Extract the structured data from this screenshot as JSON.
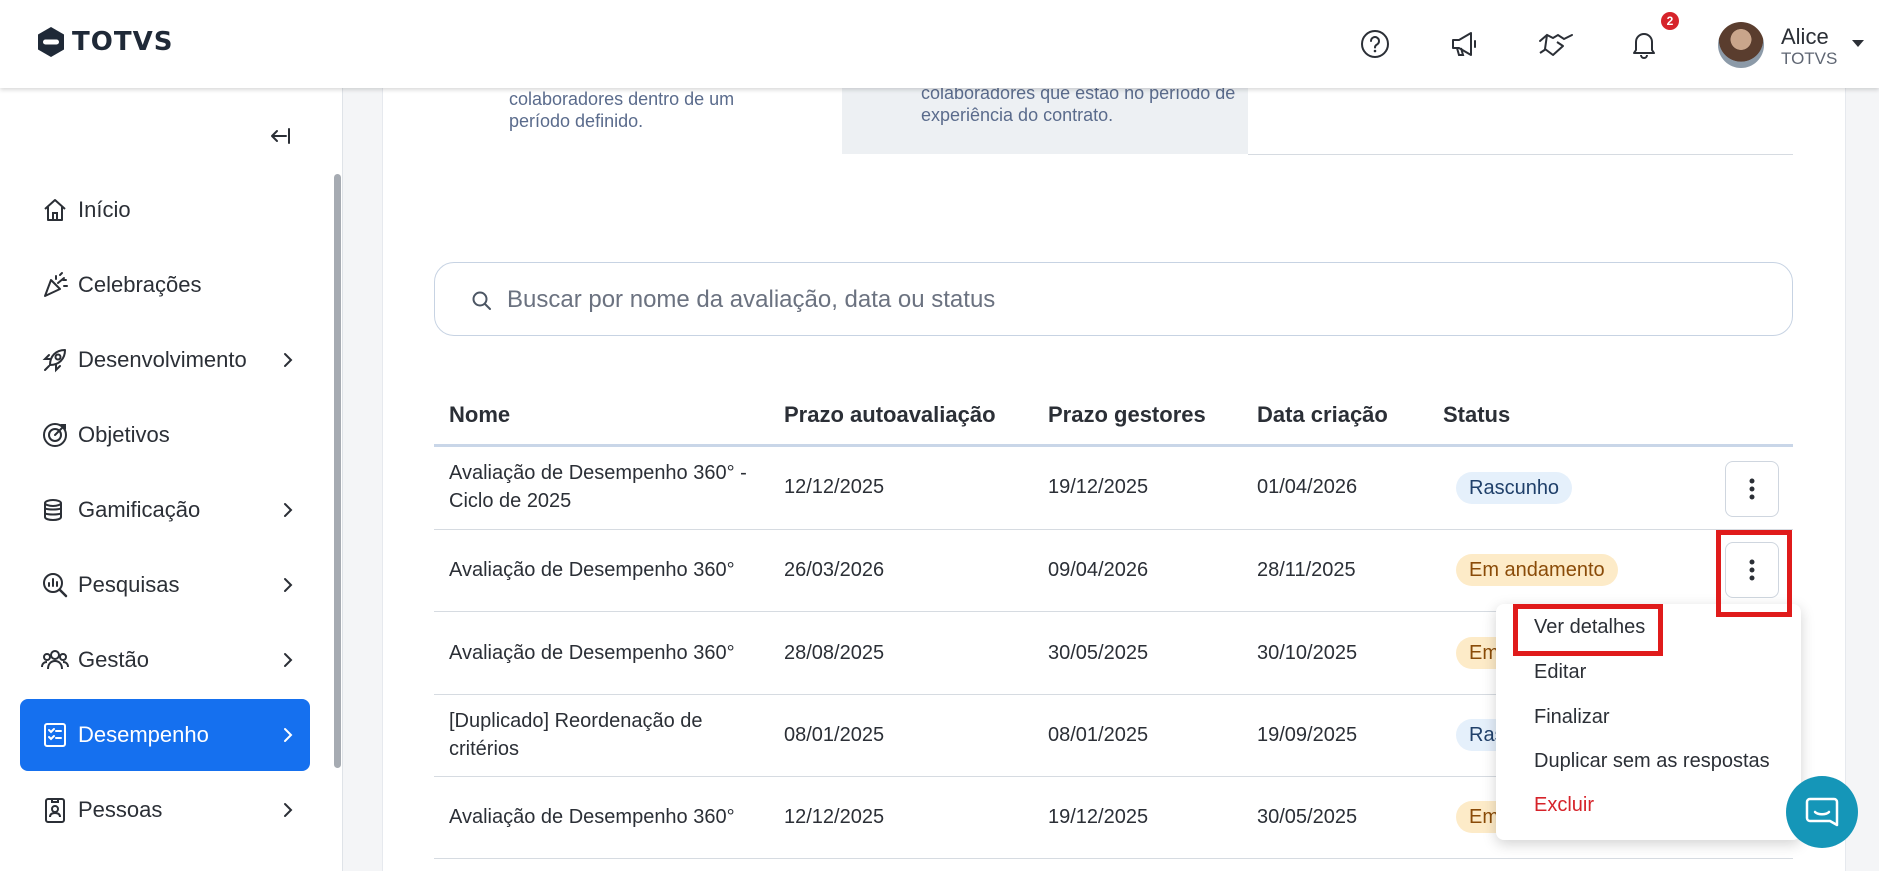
{
  "header": {
    "brand": "TOTVS",
    "notifications_count": "2",
    "user": {
      "name": "Alice",
      "org": "TOTVS"
    }
  },
  "sidebar": {
    "items": [
      {
        "label": "Início",
        "icon": "home-icon",
        "has_children": false,
        "active": false
      },
      {
        "label": "Celebrações",
        "icon": "party-popper-icon",
        "has_children": false,
        "active": false
      },
      {
        "label": "Desenvolvimento",
        "icon": "rocket-icon",
        "has_children": true,
        "active": false
      },
      {
        "label": "Objetivos",
        "icon": "target-icon",
        "has_children": false,
        "active": false
      },
      {
        "label": "Gamificação",
        "icon": "coins-icon",
        "has_children": true,
        "active": false
      },
      {
        "label": "Pesquisas",
        "icon": "search-chart-icon",
        "has_children": true,
        "active": false
      },
      {
        "label": "Gestão",
        "icon": "people-icon",
        "has_children": true,
        "active": false
      },
      {
        "label": "Desempenho",
        "icon": "checklist-icon",
        "has_children": true,
        "active": true
      },
      {
        "label": "Pessoas",
        "icon": "id-badge-icon",
        "has_children": true,
        "active": false
      }
    ]
  },
  "tabs": {
    "card1_text": "colaboradores dentro de um período definido.",
    "card2_text": "colaboradores que estão no período de experiência do contrato."
  },
  "search": {
    "placeholder": "Buscar por nome da avaliação, data ou status"
  },
  "table": {
    "headers": [
      "Nome",
      "Prazo autoavaliação",
      "Prazo gestores",
      "Data criação",
      "Status"
    ],
    "rows": [
      {
        "name": "Avaliação de Desempenho 360° - Ciclo de 2025",
        "self_deadline": "12/12/2025",
        "manager_deadline": "19/12/2025",
        "created": "01/04/2026",
        "status": "Rascunho",
        "status_color": "#e5f0fb"
      },
      {
        "name": "Avaliação de Desempenho 360°",
        "self_deadline": "26/03/2026",
        "manager_deadline": "09/04/2026",
        "created": "28/11/2025",
        "status": "Em andamento",
        "status_color": "#fdebc8"
      },
      {
        "name": "Avaliação de Desempenho 360°",
        "self_deadline": "28/08/2025",
        "manager_deadline": "30/05/2025",
        "created": "30/10/2025",
        "status": "Em",
        "status_color": "#fdebc8"
      },
      {
        "name": "[Duplicado] Reordenação de critérios",
        "self_deadline": "08/01/2025",
        "manager_deadline": "08/01/2025",
        "created": "19/09/2025",
        "status": "Ras",
        "status_color": "#e5f0fb"
      },
      {
        "name": "Avaliação de Desempenho 360°",
        "self_deadline": "12/12/2025",
        "manager_deadline": "19/12/2025",
        "created": "30/05/2025",
        "status": "Em",
        "status_color": "#fdebc8"
      }
    ]
  },
  "row_menu": {
    "items": [
      {
        "label": "Ver detalhes",
        "danger": false
      },
      {
        "label": "Editar",
        "danger": false
      },
      {
        "label": "Finalizar",
        "danger": false
      },
      {
        "label": "Duplicar sem as respostas",
        "danger": false
      },
      {
        "label": "Excluir",
        "danger": true
      }
    ]
  },
  "colors": {
    "accent": "#1570ef",
    "danger": "#d6232a",
    "highlight": "#e01b1b",
    "chat": "#1596b8"
  }
}
